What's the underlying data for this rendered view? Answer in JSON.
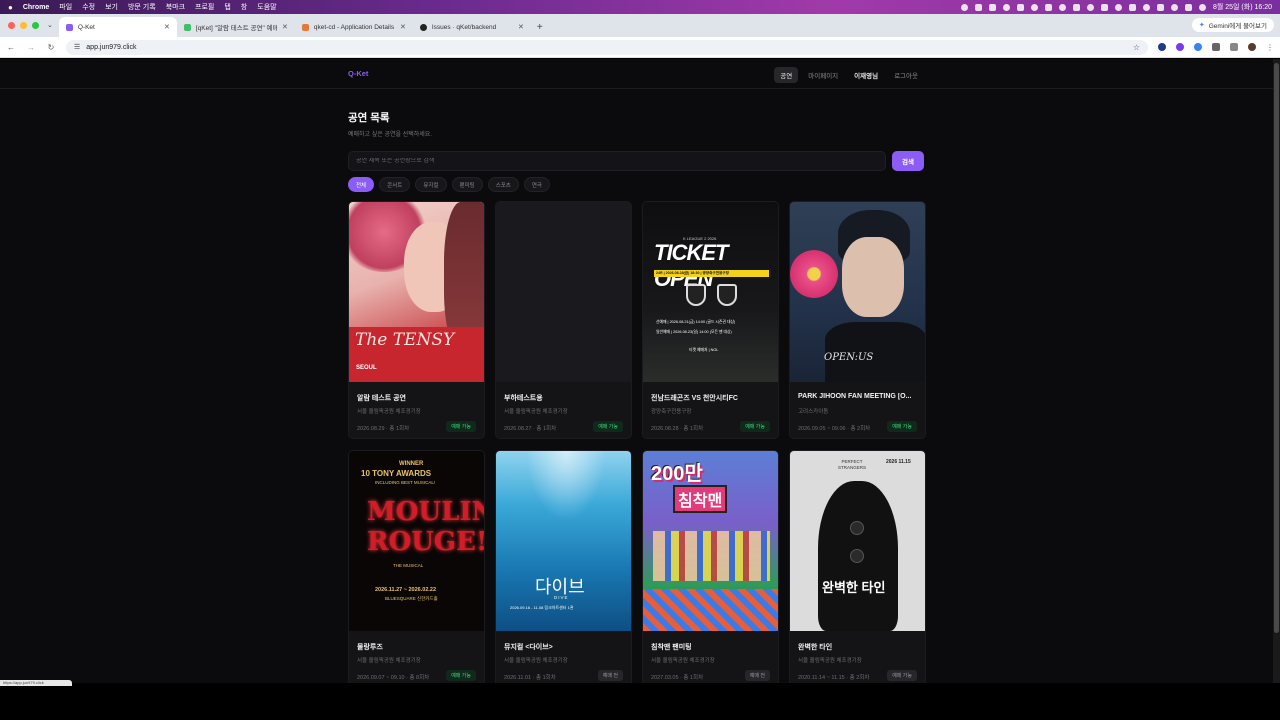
{
  "menubar": {
    "items": [
      "Chrome",
      "파일",
      "수정",
      "보기",
      "방문 기록",
      "북마크",
      "프로필",
      "탭",
      "창",
      "도움말"
    ],
    "clock": "8월 25일 (화) 16:20"
  },
  "browser": {
    "tabs": [
      {
        "label": "Q-Ket",
        "active": true,
        "color": "#8b5cf6"
      },
      {
        "label": "[qKet] \"알람 테스트 공연\" 예매",
        "active": false,
        "color": "#3cc06a"
      },
      {
        "label": "qket-cd - Application Details",
        "active": false,
        "color": "#e8773a"
      },
      {
        "label": "Issues · qKet/backend",
        "active": false,
        "color": "#222222"
      }
    ],
    "gemini_label": "Gemini에게 물어보기",
    "url": "app.jun979.click",
    "status_url": "https://app.jun979.click"
  },
  "site": {
    "logo": "Q-Ket",
    "nav": [
      {
        "label": "공연",
        "active": true
      },
      {
        "label": "마이페이지",
        "active": false
      },
      {
        "label": "이재영님",
        "active": false,
        "user": true
      },
      {
        "label": "로그아웃",
        "active": false
      }
    ],
    "heading": "공연 목록",
    "subheading": "예매하고 싶은 공연을 선택하세요.",
    "search_placeholder": "공연 제목 또는 공연장으로 검색",
    "search_button": "검색",
    "categories": [
      {
        "label": "전체",
        "active": true
      },
      {
        "label": "콘서트",
        "active": false
      },
      {
        "label": "뮤지컬",
        "active": false
      },
      {
        "label": "팬미팅",
        "active": false
      },
      {
        "label": "스포츠",
        "active": false
      },
      {
        "label": "연극",
        "active": false
      }
    ],
    "performances": [
      {
        "title": "알람 테스트 공연",
        "venue": "서울 올림픽공원 체조경기장",
        "date": "2026.08.29 · 총 1회차",
        "status": "예매 가능",
        "status_type": "open",
        "poster": "tensy",
        "poster_text": [
          "The TENSY",
          "SEOUL"
        ]
      },
      {
        "title": "부하테스트용",
        "venue": "서울 올림픽공원 체조경기장",
        "date": "2026.08.27 · 총 1회차",
        "status": "예매 가능",
        "status_type": "open",
        "poster": "empty",
        "poster_text": []
      },
      {
        "title": "전남드래곤즈 VS 천안시티FC",
        "venue": "광양축구전용구장",
        "date": "2026.08.28 · 총 1회차",
        "status": "예매 가능",
        "status_type": "open",
        "poster": "ticket",
        "poster_text": [
          "K LEAGUE 2 2026",
          "TICKET OPEN",
          "24R | 2026.08.28(금) 18:30 | 광양축구전용구장",
          "선예매 | 2026.08.21(금) 14:00 (골드 시즌권 대상)",
          "일반예매 | 2026.08.23(일) 14:00 (모든 팬 대상)",
          "티켓 예매처 | NOL"
        ]
      },
      {
        "title": "PARK JIHOON FAN MEETING [O...",
        "venue": "고려스카이돔",
        "date": "2026.09.05 ~ 09.06 · 총 2회차",
        "status": "예매 가능",
        "status_type": "open",
        "poster": "jihoon",
        "poster_text": [
          "OPEN:US"
        ]
      },
      {
        "title": "물랑루즈",
        "venue": "서울 올림픽공원 체조경기장",
        "date": "2026.09.07 ~ 09.10 · 총 8회차",
        "status": "예매 가능",
        "status_type": "open",
        "poster": "moulin",
        "poster_text": [
          "WINNER",
          "10 TONY AWARDS",
          "INCLUDING BEST MUSICAL!",
          "MOULIN",
          "ROUGE!",
          "THE MUSICAL",
          "2026.11.27 ~ 2026.02.22",
          "BLUESQUARE 신한카드홀"
        ]
      },
      {
        "title": "뮤지컬 <다이브>",
        "venue": "서울 올림픽공원 체조경기장",
        "date": "2026.11.01 · 총 1회차",
        "status": "예매 전",
        "status_type": "pending",
        "poster": "dive",
        "poster_text": [
          "다이브",
          "DIVE",
          "2026.09.16 - 11.08 링크아트센터 1관"
        ]
      },
      {
        "title": "침착맨 팬미팅",
        "venue": "서울 올림픽공원 체조경기장",
        "date": "2027.03.05 · 총 1회차",
        "status": "예매 전",
        "status_type": "pending",
        "poster": "chim",
        "poster_text": [
          "200만",
          "침착맨"
        ]
      },
      {
        "title": "완벽한 타인",
        "venue": "서울 올림픽공원 체조경기장",
        "date": "2020.11.14 ~ 11.15 · 총 2회차",
        "status": "예매 가능",
        "status_type": "pending",
        "poster": "perfect",
        "poster_text": [
          "PERFECT STRANGERS",
          "2026 11.15",
          "완벽한 타인"
        ]
      }
    ]
  }
}
